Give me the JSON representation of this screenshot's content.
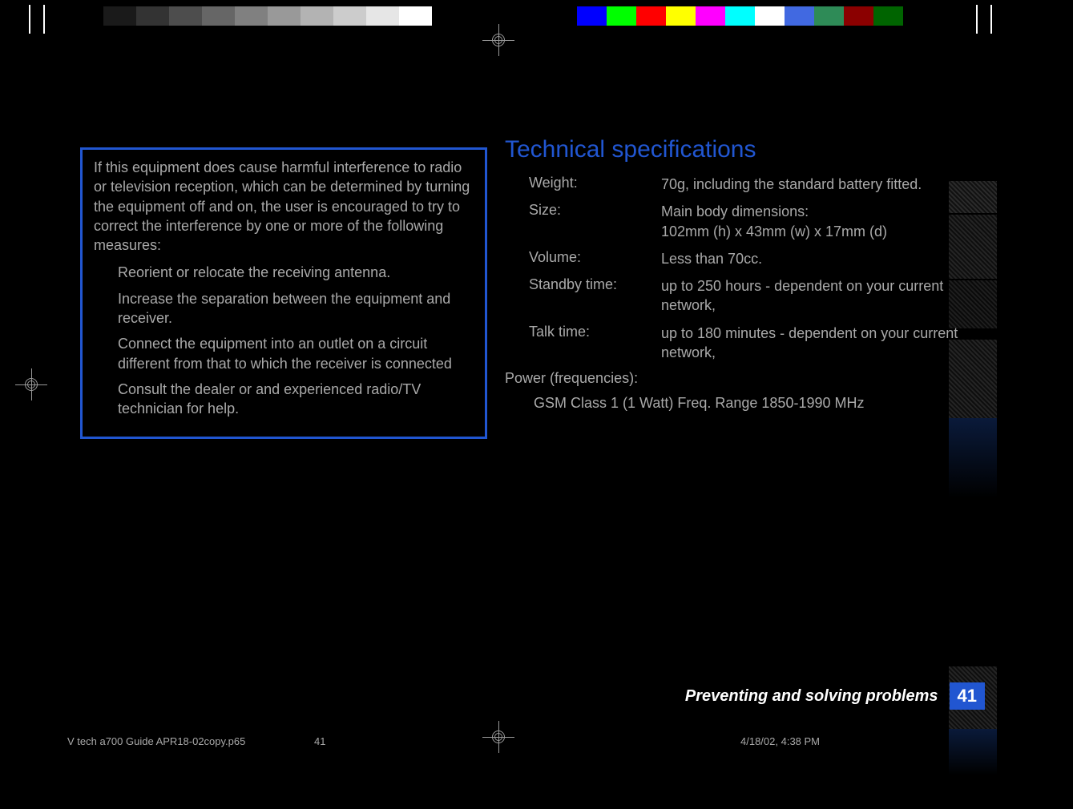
{
  "interference_box": {
    "intro": " If this equipment does cause harmful interference to radio or television reception, which can be determined by turning the equipment off and on, the user is encouraged to try to correct the interference by one or more of the following measures:",
    "items": [
      "Reorient or relocate the receiving antenna.",
      "Increase the separation between the equipment and receiver.",
      "Connect the equipment into an outlet on a circuit different from that to which the receiver is connected",
      "Consult the dealer or and experienced radio/TV technician for help."
    ]
  },
  "specs": {
    "heading": "Technical specifications",
    "rows": [
      {
        "label": "Weight:",
        "value": "70g, including the standard battery fitted."
      },
      {
        "label": "Size:",
        "value": "Main body dimensions:\n102mm (h) x 43mm (w) x 17mm (d)"
      },
      {
        "label": "Volume:",
        "value": "Less than 70cc."
      },
      {
        "label": "Standby time:",
        "value": "up to 250 hours - dependent on your current network,"
      },
      {
        "label": "Talk time:",
        "value": "up to 180 minutes - dependent on your current network,"
      }
    ],
    "power_label": "Power (frequencies):",
    "power_value": "GSM Class 1 (1 Watt) Freq. Range 1850-1990 MHz"
  },
  "footer": {
    "section_title": "Preventing and solving problems",
    "page_number": "41"
  },
  "print_meta": {
    "filename": "V tech a700 Guide APR18-02copy.p65",
    "page": "41",
    "datetime": "4/18/02, 4:38 PM"
  },
  "calibration": {
    "grays": [
      "#000000",
      "#1a1a1a",
      "#333333",
      "#4d4d4d",
      "#666666",
      "#808080",
      "#999999",
      "#b3b3b3",
      "#cccccc",
      "#e6e6e6",
      "#ffffff"
    ],
    "colors": [
      "#0000ff",
      "#00ff00",
      "#ff0000",
      "#ffff00",
      "#ff00ff",
      "#00ffff",
      "#ffffff",
      "#4169e1",
      "#2e8b57",
      "#8b0000",
      "#006400"
    ]
  }
}
